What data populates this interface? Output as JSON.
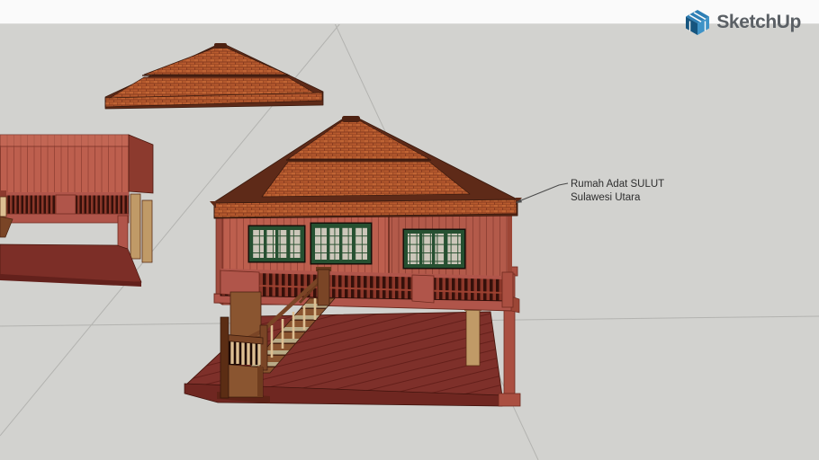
{
  "brand": {
    "name": "SketchUp",
    "icon": "sketchup-cube-icon",
    "text_color": "#5b6065",
    "blue_dark": "#16557f",
    "blue_mid": "#2e7fb5",
    "blue_light": "#3f93c7"
  },
  "header": {
    "background": "#fafafa"
  },
  "viewport": {
    "background": "#d2d2cf",
    "guide_line_color": "#b3b3b0",
    "annotation": {
      "line1": "Rumah Adat SULUT",
      "line2": "Sulawesi Utara",
      "color": "#2e2e2e",
      "leader_color": "#4a4a4a"
    },
    "palette": {
      "wall_salmon": "#bd5f4e",
      "wall_plank_line": "#9a4739",
      "wall_side_shade": "#a04b3e",
      "roof_brick": "#b3592d",
      "roof_dark_side": "#5e2a18",
      "window_green": "#265031",
      "window_pane": "#ccc7ba",
      "railing_dark": "#35100a",
      "railing_baluster": "#8c372a",
      "floor_band": "#b0554a",
      "platform_maroon": "#7e302a",
      "plinth_dark": "#6f2721",
      "post_brown": "#7a4526",
      "stair_wood": "#8a5530",
      "baluster_tan": "#ddbf92",
      "post_tan": "#c09a67"
    }
  }
}
